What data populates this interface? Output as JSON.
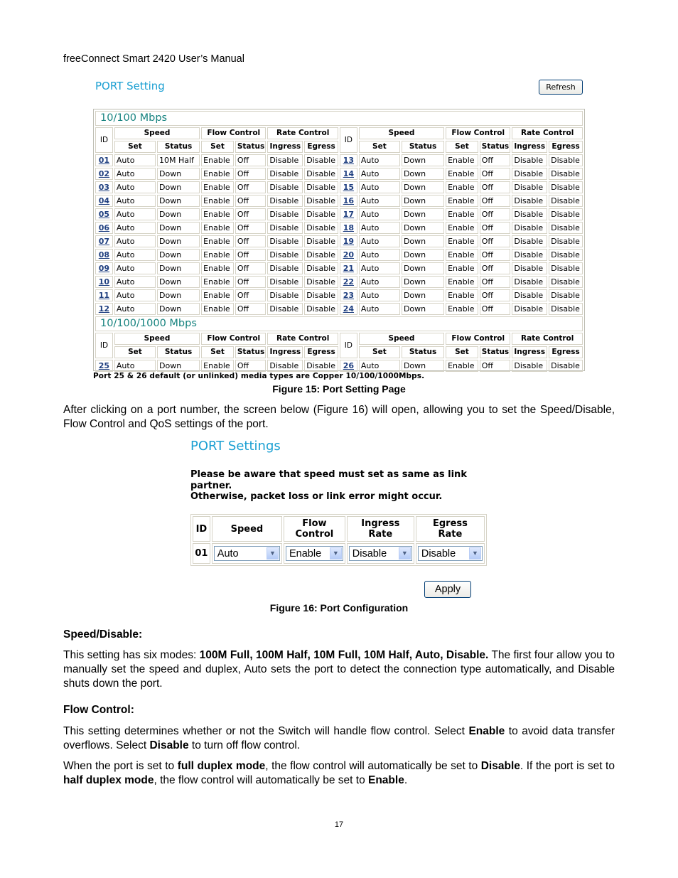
{
  "header": {
    "title": "freeConnect Smart 2420 User’s Manual"
  },
  "fig15": {
    "page_title": "PORT Setting",
    "refresh_label": "Refresh",
    "sections": [
      {
        "title": "10/100 Mbps"
      },
      {
        "title": "10/100/1000 Mbps"
      }
    ],
    "headers": {
      "id": "ID",
      "speed": "Speed",
      "flow_control": "Flow Control",
      "rate_control": "Rate Control",
      "set": "Set",
      "status": "Status",
      "ingress": "Ingress",
      "egress": "Egress"
    },
    "ports": [
      {
        "id": "01",
        "speed_set": "Auto",
        "speed_status": "10M Half",
        "fc_set": "Enable",
        "fc_status": "Off",
        "ingress": "Disable",
        "egress": "Disable"
      },
      {
        "id": "02",
        "speed_set": "Auto",
        "speed_status": "Down",
        "fc_set": "Enable",
        "fc_status": "Off",
        "ingress": "Disable",
        "egress": "Disable"
      },
      {
        "id": "03",
        "speed_set": "Auto",
        "speed_status": "Down",
        "fc_set": "Enable",
        "fc_status": "Off",
        "ingress": "Disable",
        "egress": "Disable"
      },
      {
        "id": "04",
        "speed_set": "Auto",
        "speed_status": "Down",
        "fc_set": "Enable",
        "fc_status": "Off",
        "ingress": "Disable",
        "egress": "Disable"
      },
      {
        "id": "05",
        "speed_set": "Auto",
        "speed_status": "Down",
        "fc_set": "Enable",
        "fc_status": "Off",
        "ingress": "Disable",
        "egress": "Disable"
      },
      {
        "id": "06",
        "speed_set": "Auto",
        "speed_status": "Down",
        "fc_set": "Enable",
        "fc_status": "Off",
        "ingress": "Disable",
        "egress": "Disable"
      },
      {
        "id": "07",
        "speed_set": "Auto",
        "speed_status": "Down",
        "fc_set": "Enable",
        "fc_status": "Off",
        "ingress": "Disable",
        "egress": "Disable"
      },
      {
        "id": "08",
        "speed_set": "Auto",
        "speed_status": "Down",
        "fc_set": "Enable",
        "fc_status": "Off",
        "ingress": "Disable",
        "egress": "Disable"
      },
      {
        "id": "09",
        "speed_set": "Auto",
        "speed_status": "Down",
        "fc_set": "Enable",
        "fc_status": "Off",
        "ingress": "Disable",
        "egress": "Disable"
      },
      {
        "id": "10",
        "speed_set": "Auto",
        "speed_status": "Down",
        "fc_set": "Enable",
        "fc_status": "Off",
        "ingress": "Disable",
        "egress": "Disable"
      },
      {
        "id": "11",
        "speed_set": "Auto",
        "speed_status": "Down",
        "fc_set": "Enable",
        "fc_status": "Off",
        "ingress": "Disable",
        "egress": "Disable"
      },
      {
        "id": "12",
        "speed_set": "Auto",
        "speed_status": "Down",
        "fc_set": "Enable",
        "fc_status": "Off",
        "ingress": "Disable",
        "egress": "Disable"
      },
      {
        "id": "13",
        "speed_set": "Auto",
        "speed_status": "Down",
        "fc_set": "Enable",
        "fc_status": "Off",
        "ingress": "Disable",
        "egress": "Disable"
      },
      {
        "id": "14",
        "speed_set": "Auto",
        "speed_status": "Down",
        "fc_set": "Enable",
        "fc_status": "Off",
        "ingress": "Disable",
        "egress": "Disable"
      },
      {
        "id": "15",
        "speed_set": "Auto",
        "speed_status": "Down",
        "fc_set": "Enable",
        "fc_status": "Off",
        "ingress": "Disable",
        "egress": "Disable"
      },
      {
        "id": "16",
        "speed_set": "Auto",
        "speed_status": "Down",
        "fc_set": "Enable",
        "fc_status": "Off",
        "ingress": "Disable",
        "egress": "Disable"
      },
      {
        "id": "17",
        "speed_set": "Auto",
        "speed_status": "Down",
        "fc_set": "Enable",
        "fc_status": "Off",
        "ingress": "Disable",
        "egress": "Disable"
      },
      {
        "id": "18",
        "speed_set": "Auto",
        "speed_status": "Down",
        "fc_set": "Enable",
        "fc_status": "Off",
        "ingress": "Disable",
        "egress": "Disable"
      },
      {
        "id": "19",
        "speed_set": "Auto",
        "speed_status": "Down",
        "fc_set": "Enable",
        "fc_status": "Off",
        "ingress": "Disable",
        "egress": "Disable"
      },
      {
        "id": "20",
        "speed_set": "Auto",
        "speed_status": "Down",
        "fc_set": "Enable",
        "fc_status": "Off",
        "ingress": "Disable",
        "egress": "Disable"
      },
      {
        "id": "21",
        "speed_set": "Auto",
        "speed_status": "Down",
        "fc_set": "Enable",
        "fc_status": "Off",
        "ingress": "Disable",
        "egress": "Disable"
      },
      {
        "id": "22",
        "speed_set": "Auto",
        "speed_status": "Down",
        "fc_set": "Enable",
        "fc_status": "Off",
        "ingress": "Disable",
        "egress": "Disable"
      },
      {
        "id": "23",
        "speed_set": "Auto",
        "speed_status": "Down",
        "fc_set": "Enable",
        "fc_status": "Off",
        "ingress": "Disable",
        "egress": "Disable"
      },
      {
        "id": "24",
        "speed_set": "Auto",
        "speed_status": "Down",
        "fc_set": "Enable",
        "fc_status": "Off",
        "ingress": "Disable",
        "egress": "Disable"
      },
      {
        "id": "25",
        "speed_set": "Auto",
        "speed_status": "Down",
        "fc_set": "Enable",
        "fc_status": "Off",
        "ingress": "Disable",
        "egress": "Disable"
      },
      {
        "id": "26",
        "speed_set": "Auto",
        "speed_status": "Down",
        "fc_set": "Enable",
        "fc_status": "Off",
        "ingress": "Disable",
        "egress": "Disable"
      }
    ],
    "note": "Port 25 & 26 default (or unlinked) media types are Copper 10/100/1000Mbps.",
    "caption": "Figure 15: Port Setting Page"
  },
  "intro_para": "After clicking on a port number, the screen below (Figure 16) will open, allowing you to set the Speed/Disable, Flow Control and QoS settings of the port.",
  "fig16": {
    "page_title": "PORT Settings",
    "warning_line1": "Please be aware that speed must set as same as link partner.",
    "warning_line2": "Otherwise, packet loss or link error might occur.",
    "headers": {
      "id": "ID",
      "speed": "Speed",
      "flow_control": "Flow Control",
      "ingress_rate": "Ingress Rate",
      "egress_rate": "Egress Rate"
    },
    "row": {
      "id": "01",
      "speed": "Auto",
      "flow_control": "Enable",
      "ingress_rate": "Disable",
      "egress_rate": "Disable"
    },
    "apply_label": "Apply",
    "caption": "Figure 16: Port Configuration"
  },
  "speed_section": {
    "heading": "Speed/Disable:",
    "text_before": "This setting has six modes: ",
    "modes_bold": "100M Full, 100M Half, 10M Full, 10M Half, Auto, Disable.",
    "text_after": "  The first four allow you to manually set the speed and duplex, Auto sets the port to detect the connection type automatically, and Disable shuts down the port."
  },
  "flow_section": {
    "heading": "Flow Control:",
    "p1": [
      "This setting determines whether or not the Switch will handle flow control. Select ",
      "Enable",
      " to avoid data transfer overflows. Select ",
      "Disable",
      " to turn off flow control."
    ],
    "p2": [
      "When the port is set to ",
      "full duplex mode",
      ", the flow control will automatically be set to ",
      "Disable",
      ".  If the port is set to ",
      "half duplex mode",
      ", the flow control will automatically be set to ",
      "Enable",
      "."
    ]
  },
  "footer": {
    "page_number": "17"
  }
}
